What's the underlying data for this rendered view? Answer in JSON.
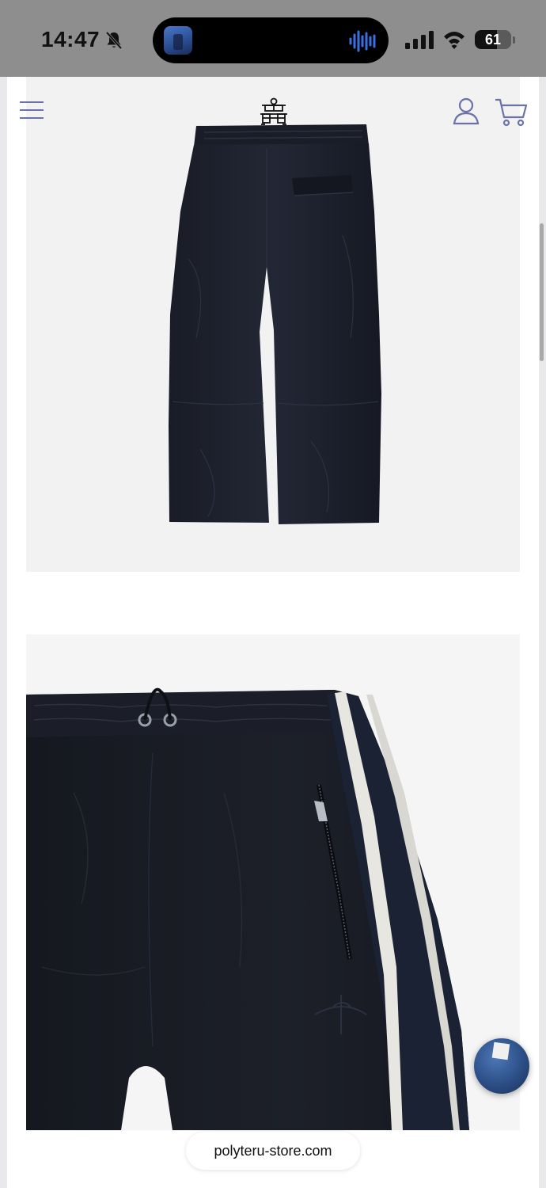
{
  "status_bar": {
    "time": "14:47",
    "battery_percent": "61",
    "battery_level": 0.61,
    "icons": [
      "bell-slash-icon",
      "signal-icon",
      "wifi-icon",
      "battery-icon"
    ],
    "dynamic_island": {
      "icons": [
        "now-playing-thumbnail",
        "audio-waveform-icon"
      ],
      "waveform_color": "#3b6fe0"
    }
  },
  "header": {
    "icons": [
      "menu-icon",
      "brand-logo",
      "account-icon",
      "cart-icon"
    ],
    "icon_color": "#6b72a8"
  },
  "gallery": {
    "images": [
      {
        "subject": "black pants, back view"
      },
      {
        "subject": "black track pants with white side stripe, close-up"
      }
    ]
  },
  "chat_widget": {
    "icon": "chat-widget-thumbnail"
  },
  "browser": {
    "url": "polyteru-store.com"
  }
}
